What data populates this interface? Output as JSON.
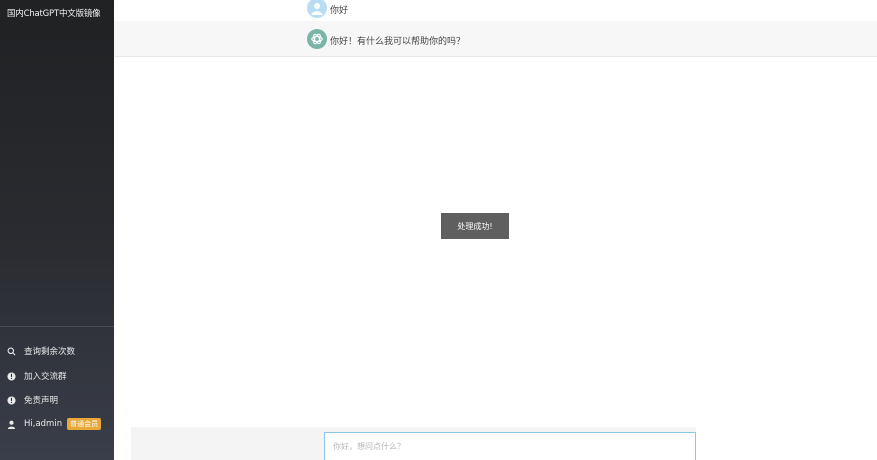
{
  "sidebar": {
    "brand": "国内ChatGPT中文版镜像",
    "menu": {
      "query_remaining": "查询剩余次数",
      "join_group": "加入交流群",
      "disclaimer": "免责声明",
      "user": "Hi,admin",
      "vip_badge": "普通会员"
    }
  },
  "chat": {
    "messages": [
      {
        "role": "user",
        "text": "你好"
      },
      {
        "role": "assistant",
        "text": "你好！有什么我可以帮助你的吗？"
      }
    ]
  },
  "toast": {
    "text": "处理成功!"
  },
  "input": {
    "placeholder": "你好，想问点什么？",
    "value": ""
  },
  "icons": {
    "query": "search-icon",
    "group": "info-icon",
    "disclaimer": "info-icon",
    "user": "user-icon",
    "user_avatar": "user-avatar-icon",
    "assistant_avatar": "openai-logo-icon"
  },
  "colors": {
    "sidebar_bg": "#202123",
    "vip_badge": "#e8a93a",
    "toast_bg": "#5f5f5f",
    "input_border": "#8cc6e8"
  }
}
